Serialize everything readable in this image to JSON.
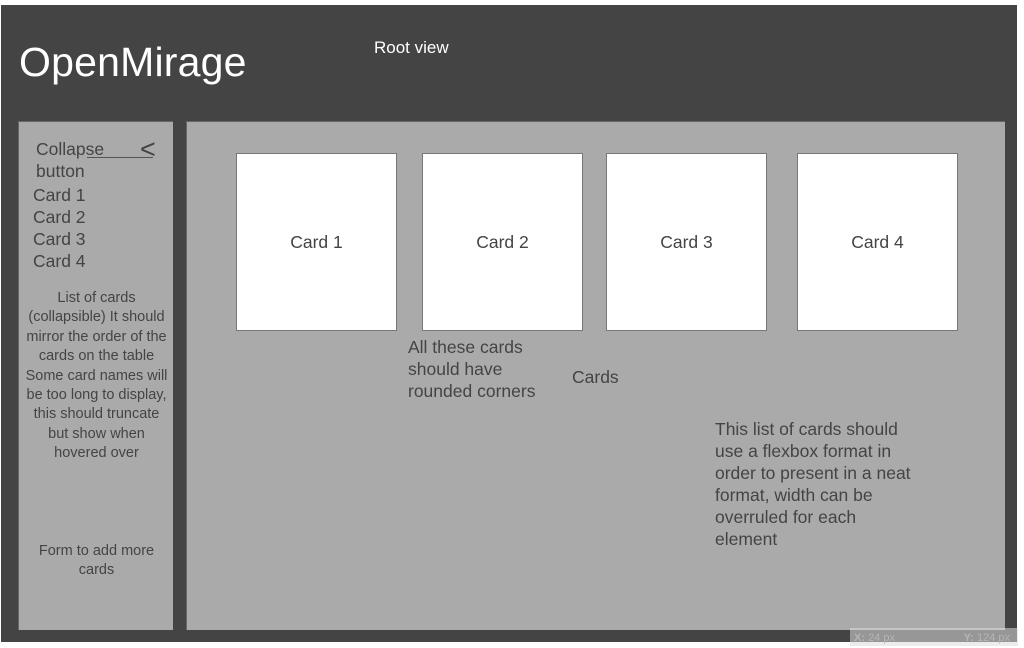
{
  "header": {
    "app_title": "OpenMirage",
    "view_label": "Root view"
  },
  "sidebar": {
    "collapse_label": "Collapse button",
    "collapse_icon": "<",
    "cards": [
      "Card 1",
      "Card 2",
      "Card 3",
      "Card 4"
    ],
    "note": "List of cards (collapsible) It should mirror the order of the cards on the table Some card names will be too long to display, this should truncate but show when hovered over",
    "form_note": "Form to add more cards"
  },
  "main": {
    "cards": [
      {
        "label": "Card 1"
      },
      {
        "label": "Card 2"
      },
      {
        "label": "Card 3"
      },
      {
        "label": "Card 4"
      }
    ],
    "notes": {
      "rounded": "All these cards should have rounded corners",
      "cards_label": "Cards",
      "flexbox": "This list of cards should use a flexbox format in order to present in a neat format, width can be overruled for each element"
    }
  },
  "cursor_readout": {
    "x_label": "X:",
    "x_value": "24 px",
    "y_label": "Y:",
    "y_value": "124 px"
  },
  "colors": {
    "frame": "#444444",
    "panel": "#aaaaaa",
    "card": "#ffffff",
    "text_dark": "#444444",
    "text_light": "#ffffff"
  }
}
